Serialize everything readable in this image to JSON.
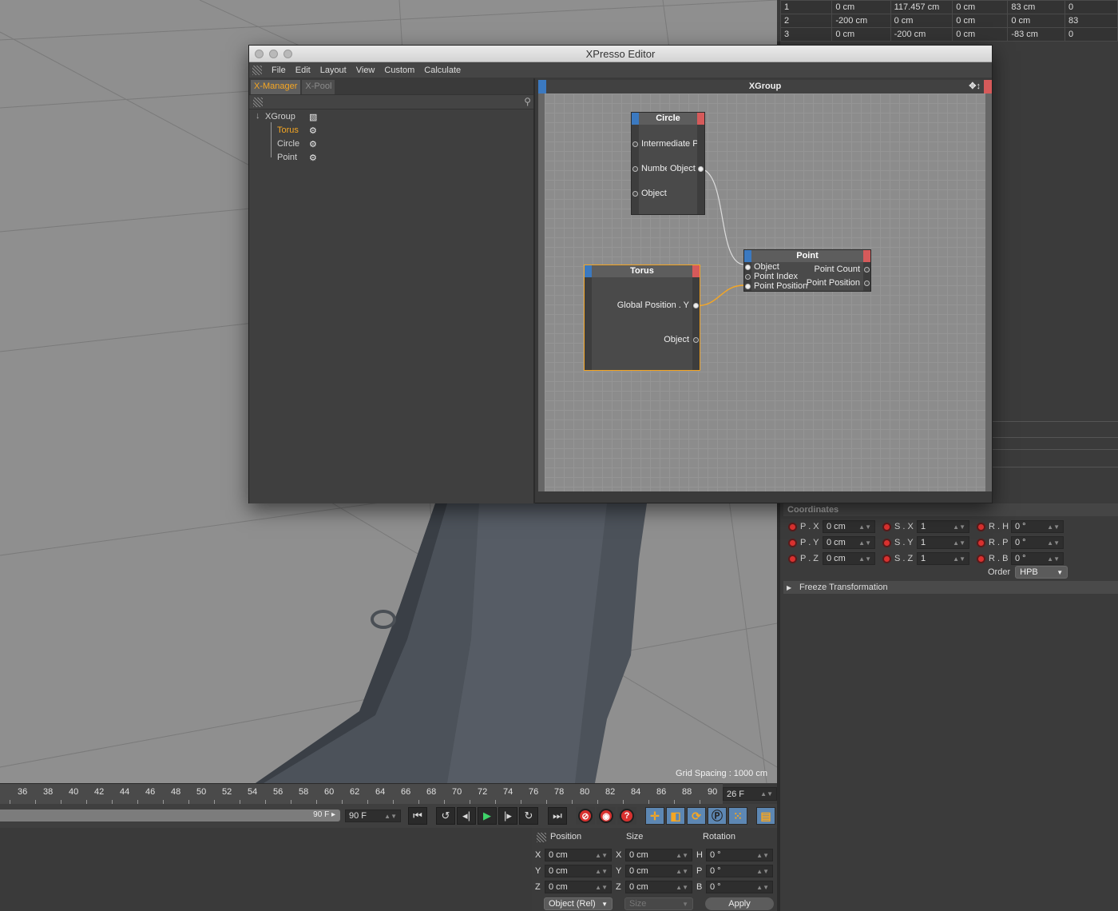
{
  "coord_table": {
    "rows": [
      [
        "1",
        "0 cm",
        "117.457 cm",
        "0 cm",
        "83 cm",
        "0"
      ],
      [
        "2",
        "-200 cm",
        "0 cm",
        "0 cm",
        "0 cm",
        "83"
      ],
      [
        "3",
        "0 cm",
        "-200 cm",
        "0 cm",
        "-83 cm",
        "0"
      ]
    ]
  },
  "viewport": {
    "grid_spacing": "Grid Spacing : 1000 cm"
  },
  "xpresso": {
    "title": "XPresso Editor",
    "menu": [
      "File",
      "Edit",
      "Layout",
      "View",
      "Custom",
      "Calculate"
    ],
    "tabs": [
      "X-Manager",
      "X-Pool"
    ],
    "tree": {
      "root": "XGroup",
      "children": [
        "Torus",
        "Circle",
        "Point"
      ],
      "selected": "Torus"
    },
    "group_title": "XGroup",
    "nodes": {
      "circle": {
        "title": "Circle",
        "ports": [
          "Intermediate Po",
          "Numbe",
          "Object",
          "Object"
        ]
      },
      "torus": {
        "title": "Torus",
        "ports": [
          "Global Position . Y",
          "Object"
        ]
      },
      "point": {
        "title": "Point",
        "in_ports": [
          "Object",
          "Point Index",
          "Point Position"
        ],
        "out_ports": [
          "Point Count",
          "Point Position"
        ]
      }
    }
  },
  "attributes": {
    "section": "Coordinates",
    "rows": [
      [
        [
          "P . X",
          "0 cm"
        ],
        [
          "S . X",
          "1"
        ],
        [
          "R . H",
          "0 °"
        ]
      ],
      [
        [
          "P . Y",
          "0 cm"
        ],
        [
          "S . Y",
          "1"
        ],
        [
          "R . P",
          "0 °"
        ]
      ],
      [
        [
          "P . Z",
          "0 cm"
        ],
        [
          "S . Z",
          "1"
        ],
        [
          "R . B",
          "0 °"
        ]
      ]
    ],
    "order_label": "Order",
    "order_value": "HPB",
    "freeze": "Freeze Transformation"
  },
  "timeline": {
    "ticks": [
      "36",
      "38",
      "40",
      "42",
      "44",
      "46",
      "48",
      "50",
      "52",
      "54",
      "56",
      "58",
      "60",
      "62",
      "64",
      "66",
      "68",
      "70",
      "72",
      "74",
      "76",
      "78",
      "80",
      "82",
      "84",
      "86",
      "88",
      "90"
    ],
    "current_frame": "26 F",
    "slider_end": "90 F",
    "end_frame": "90 F"
  },
  "coord_manager": {
    "headers": [
      "Position",
      "Size",
      "Rotation"
    ],
    "rows": [
      [
        "X",
        "0 cm",
        "X",
        "0 cm",
        "H",
        "0 °"
      ],
      [
        "Y",
        "0 cm",
        "Y",
        "0 cm",
        "P",
        "0 °"
      ],
      [
        "Z",
        "0 cm",
        "Z",
        "0 cm",
        "B",
        "0 °"
      ]
    ],
    "mode": "Object (Rel)",
    "size_mode": "Size",
    "apply": "Apply"
  }
}
